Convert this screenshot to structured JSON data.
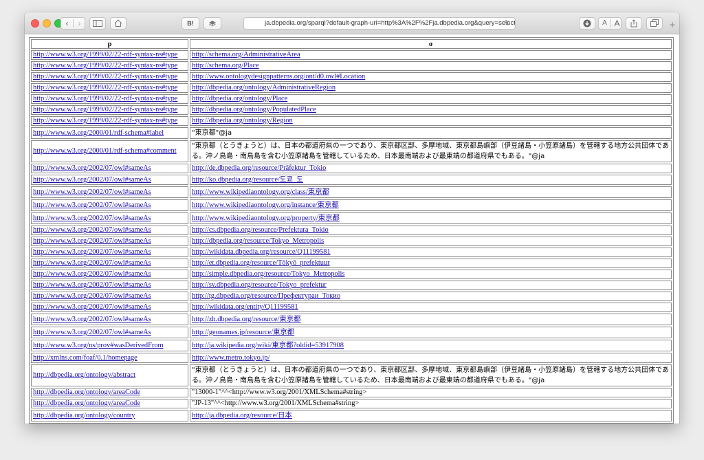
{
  "browser": {
    "address_url": "ja.dbpedia.org/sparql?default-graph-uri=http%3A%2F%2Fja.dbpedia.org&query=select+distinc",
    "bookmark_label": "B!",
    "text_small": "A",
    "text_large": "A",
    "new_tab_label": "+"
  },
  "table": {
    "headers": {
      "p": "p",
      "o": "o"
    },
    "rows": [
      {
        "p": "http://www.w3.org/1999/02/22-rdf-syntax-ns#type",
        "o": "http://schema.org/AdministrativeArea"
      },
      {
        "p": "http://www.w3.org/1999/02/22-rdf-syntax-ns#type",
        "o": "http://schema.org/Place"
      },
      {
        "p": "http://www.w3.org/1999/02/22-rdf-syntax-ns#type",
        "o": "http://www.ontologydesignpatterns.org/ont/d0.owl#Location"
      },
      {
        "p": "http://www.w3.org/1999/02/22-rdf-syntax-ns#type",
        "o": "http://dbpedia.org/ontology/AdministrativeRegion"
      },
      {
        "p": "http://www.w3.org/1999/02/22-rdf-syntax-ns#type",
        "o": "http://dbpedia.org/ontology/Place"
      },
      {
        "p": "http://www.w3.org/1999/02/22-rdf-syntax-ns#type",
        "o": "http://dbpedia.org/ontology/PopulatedPlace"
      },
      {
        "p": "http://www.w3.org/1999/02/22-rdf-syntax-ns#type",
        "o": "http://dbpedia.org/ontology/Region"
      },
      {
        "p": "http://www.w3.org/2000/01/rdf-schema#label",
        "o": "\"東京都\"@ja"
      },
      {
        "p": "http://www.w3.org/2000/01/rdf-schema#comment",
        "o": "\"東京都（とうきょうと）は、日本の都道府県の一つであり、東京都区部、多摩地域、東京都島嶼部（伊豆諸島・小笠原諸島）を管轄する地方公共団体である。沖ノ鳥島・南鳥島を含む小笠原諸島を管轄しているため、日本最南端および最東端の都道府県でもある。\"@ja"
      },
      {
        "p": "http://www.w3.org/2002/07/owl#sameAs",
        "o": "http://de.dbpedia.org/resource/Präfektur_Tokio"
      },
      {
        "p": "http://www.w3.org/2002/07/owl#sameAs",
        "o": "http://ko.dbpedia.org/resource/도쿄_도"
      },
      {
        "p": "http://www.w3.org/2002/07/owl#sameAs",
        "o": "http://www.wikipediaontology.org/class/東京都"
      },
      {
        "p": "http://www.w3.org/2002/07/owl#sameAs",
        "o": "http://www.wikipediaontology.org/instance/東京都"
      },
      {
        "p": "http://www.w3.org/2002/07/owl#sameAs",
        "o": "http://www.wikipediaontology.org/property/東京都"
      },
      {
        "p": "http://www.w3.org/2002/07/owl#sameAs",
        "o": "http://cs.dbpedia.org/resource/Prefektura_Tokio"
      },
      {
        "p": "http://www.w3.org/2002/07/owl#sameAs",
        "o": "http://dbpedia.org/resource/Tokyo_Metropolis"
      },
      {
        "p": "http://www.w3.org/2002/07/owl#sameAs",
        "o": "http://wikidata.dbpedia.org/resource/Q11199581"
      },
      {
        "p": "http://www.w3.org/2002/07/owl#sameAs",
        "o": "http://et.dbpedia.org/resource/Tōkyō_prefektuur"
      },
      {
        "p": "http://www.w3.org/2002/07/owl#sameAs",
        "o": "http://simple.dbpedia.org/resource/Tokyo_Metropolis"
      },
      {
        "p": "http://www.w3.org/2002/07/owl#sameAs",
        "o": "http://sv.dbpedia.org/resource/Tokyo_prefektur"
      },
      {
        "p": "http://www.w3.org/2002/07/owl#sameAs",
        "o": "http://tg.dbpedia.org/resource/Префектураи_Токио"
      },
      {
        "p": "http://www.w3.org/2002/07/owl#sameAs",
        "o": "http://wikidata.org/entity/Q11199581"
      },
      {
        "p": "http://www.w3.org/2002/07/owl#sameAs",
        "o": "http://zh.dbpedia.org/resource/東京都"
      },
      {
        "p": "http://www.w3.org/2002/07/owl#sameAs",
        "o": "http://geonames.jp/resource/東京都"
      },
      {
        "p": "http://www.w3.org/ns/prov#wasDerivedFrom",
        "o": "http://ja.wikipedia.org/wiki/東京都?oldid=53917908"
      },
      {
        "p": "http://xmlns.com/foaf/0.1/homepage",
        "o": "http://www.metro.tokyo.jp/"
      },
      {
        "p": "http://dbpedia.org/ontology/abstract",
        "o": "\"東京都（とうきょうと）は、日本の都道府県の一つであり、東京都区部、多摩地域、東京都島嶼部（伊豆諸島・小笠原諸島）を管轄する地方公共団体である。沖ノ鳥島・南鳥島を含む小笠原諸島を管轄しているため、日本最南端および最東端の都道府県でもある。\"@ja"
      },
      {
        "p": "http://dbpedia.org/ontology/areaCode",
        "o": "\"13000-1\"^^<http://www.w3.org/2001/XMLSchema#string>"
      },
      {
        "p": "http://dbpedia.org/ontology/areaCode",
        "o": "\"JP-13\"^^<http://www.w3.org/2001/XMLSchema#string>"
      },
      {
        "p": "http://dbpedia.org/ontology/country",
        "o": "http://ja.dbpedia.org/resource/日本"
      }
    ]
  }
}
